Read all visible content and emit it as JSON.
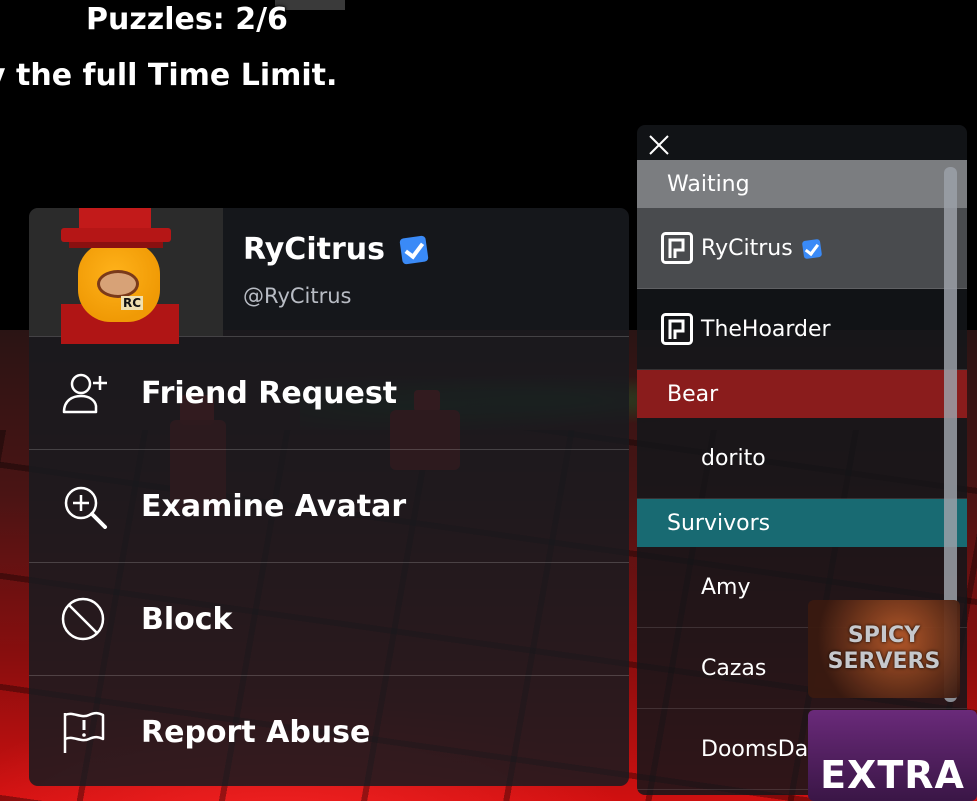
{
  "hud": {
    "puzzles": "Puzzles: 2/6",
    "time_message": "y the full Time Limit."
  },
  "player_menu": {
    "display_name": "RyCitrus",
    "username": "@RyCitrus",
    "avatar_badge": "RC",
    "items": [
      {
        "label": "Friend Request",
        "icon": "add-friend-icon"
      },
      {
        "label": "Examine Avatar",
        "icon": "examine-icon"
      },
      {
        "label": "Block",
        "icon": "block-icon"
      },
      {
        "label": "Report Abuse",
        "icon": "report-flag-icon"
      }
    ]
  },
  "leaderboard": {
    "teams": [
      {
        "name": "Waiting",
        "color": "#7b7d80",
        "players": [
          "RyCitrus",
          "TheHoarder"
        ]
      },
      {
        "name": "Bear",
        "color": "#8a1c1c",
        "players": [
          "dorito"
        ]
      },
      {
        "name": "Survivors",
        "color": "#186a72",
        "players": [
          "Amy",
          "Cazas",
          "DoomsDayHour"
        ]
      }
    ]
  },
  "ads": {
    "spicy_line1": "SPICY",
    "spicy_line2": "SERVERS",
    "extra": "EXTRA"
  }
}
